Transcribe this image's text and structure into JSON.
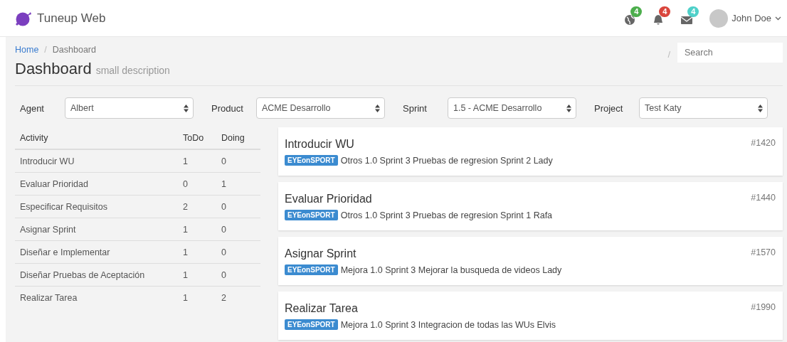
{
  "brand": {
    "name": "Tuneup Web"
  },
  "header_icons": [
    {
      "kind": "globe",
      "count": "4",
      "color": "#4cae4c"
    },
    {
      "kind": "bell",
      "count": "4",
      "color": "#d9453c"
    },
    {
      "kind": "mail",
      "count": "4",
      "color": "#4fd0c9"
    }
  ],
  "user": {
    "name": "John Doe"
  },
  "breadcrumb": {
    "separator": "/",
    "items": [
      {
        "label": "Home",
        "kind": "link"
      },
      {
        "label": "Dashboard",
        "kind": "current"
      }
    ]
  },
  "search": {
    "separator": "/",
    "placeholder": "Search"
  },
  "page": {
    "title": "Dashboard",
    "subtitle": "small description"
  },
  "filters": [
    {
      "label": "Agent",
      "value": "Albert"
    },
    {
      "label": "Product",
      "value": "ACME Desarrollo"
    },
    {
      "label": "Sprint",
      "value": "1.5 - ACME Desarrollo"
    },
    {
      "label": "Project",
      "value": "Test Katy"
    }
  ],
  "table": {
    "columns": [
      "Activity",
      "ToDo",
      "Doing"
    ],
    "rows": [
      [
        "Introducir WU",
        "1",
        "0"
      ],
      [
        "Evaluar Prioridad",
        "0",
        "1"
      ],
      [
        "Especificar Requisitos",
        "2",
        "0"
      ],
      [
        "Asignar Sprint",
        "1",
        "0"
      ],
      [
        "Diseñar e Implementar",
        "1",
        "0"
      ],
      [
        "Diseñar Pruebas de Aceptación",
        "1",
        "0"
      ],
      [
        "Realizar Tarea",
        "1",
        "2"
      ]
    ]
  },
  "cards": [
    {
      "title": "Introducir WU",
      "number": "#1420",
      "tag": "EYEonSPORT",
      "text": "Otros 1.0 Sprint 3 Pruebas de regresion Sprint 2 Lady"
    },
    {
      "title": "Evaluar Prioridad",
      "number": "#1440",
      "tag": "EYEonSPORT",
      "text": "Otros 1.0 Sprint 3 Pruebas de regresion Sprint 1 Rafa"
    },
    {
      "title": "Asignar Sprint",
      "number": "#1570",
      "tag": "EYEonSPORT",
      "text": "Mejora 1.0 Sprint 3 Mejorar la busqueda de videos Lady"
    },
    {
      "title": "Realizar Tarea",
      "number": "#1990",
      "tag": "EYEonSPORT",
      "text": "Mejora 1.0 Sprint 3 Integracion de todas las WUs Elvis"
    }
  ]
}
